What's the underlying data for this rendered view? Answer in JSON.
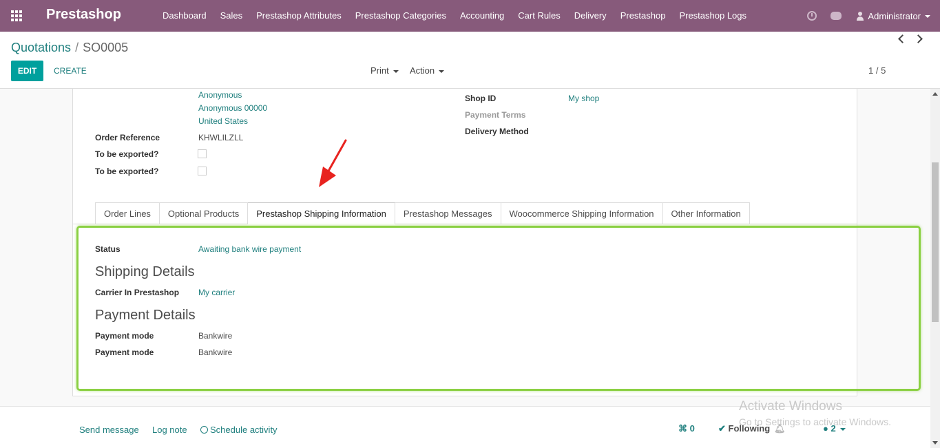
{
  "navbar": {
    "brand": "Prestashop",
    "menu": [
      "Dashboard",
      "Sales",
      "Prestashop Attributes",
      "Prestashop Categories",
      "Accounting",
      "Cart Rules",
      "Delivery",
      "Prestashop",
      "Prestashop Logs"
    ],
    "user": "Administrator"
  },
  "breadcrumb": {
    "parent": "Quotations",
    "separator": "/",
    "current": "SO0005"
  },
  "buttons": {
    "edit": "EDIT",
    "create": "CREATE",
    "print": "Print",
    "action": "Action"
  },
  "pager": "1 / 5",
  "address": [
    "Anonymous",
    "Anonymous 00000",
    "United States"
  ],
  "fields": {
    "order_reference_label": "Order Reference",
    "order_reference_value": "KHWLILZLL",
    "to_be_exported_1": "To be exported?",
    "to_be_exported_2": "To be exported?",
    "shop_id_label": "Shop ID",
    "shop_id_value": "My shop",
    "payment_terms_label": "Payment Terms",
    "delivery_method_label": "Delivery Method"
  },
  "tabs": [
    "Order Lines",
    "Optional Products",
    "Prestashop Shipping Information",
    "Prestashop Messages",
    "Woocommerce Shipping Information",
    "Other Information"
  ],
  "shipping_tab": {
    "status_label": "Status",
    "status_value": "Awaiting bank wire payment",
    "shipping_details_title": "Shipping Details",
    "carrier_label": "Carrier In Prestashop",
    "carrier_value": "My carrier",
    "payment_details_title": "Payment Details",
    "payment_mode_label_1": "Payment mode",
    "payment_mode_value_1": "Bankwire",
    "payment_mode_label_2": "Payment mode",
    "payment_mode_value_2": "Bankwire"
  },
  "chatter": {
    "send_message": "Send message",
    "log_note": "Log note",
    "schedule_activity": "Schedule activity",
    "attachments": "0",
    "following": "Following",
    "followers": "2"
  },
  "watermark": {
    "line1": "Activate Windows",
    "line2": "Go to Settings to activate Windows."
  },
  "colors": {
    "navbar": "#875a7b",
    "primary": "#00a09d",
    "link": "#1f7f7e",
    "highlight": "#8bd043",
    "arrow": "#e8231f"
  },
  "icons": [
    "apps-grid-icon",
    "clock-icon",
    "chat-icon",
    "user-icon",
    "paperclip-icon",
    "check-icon",
    "bell-icon",
    "followers-icon"
  ]
}
